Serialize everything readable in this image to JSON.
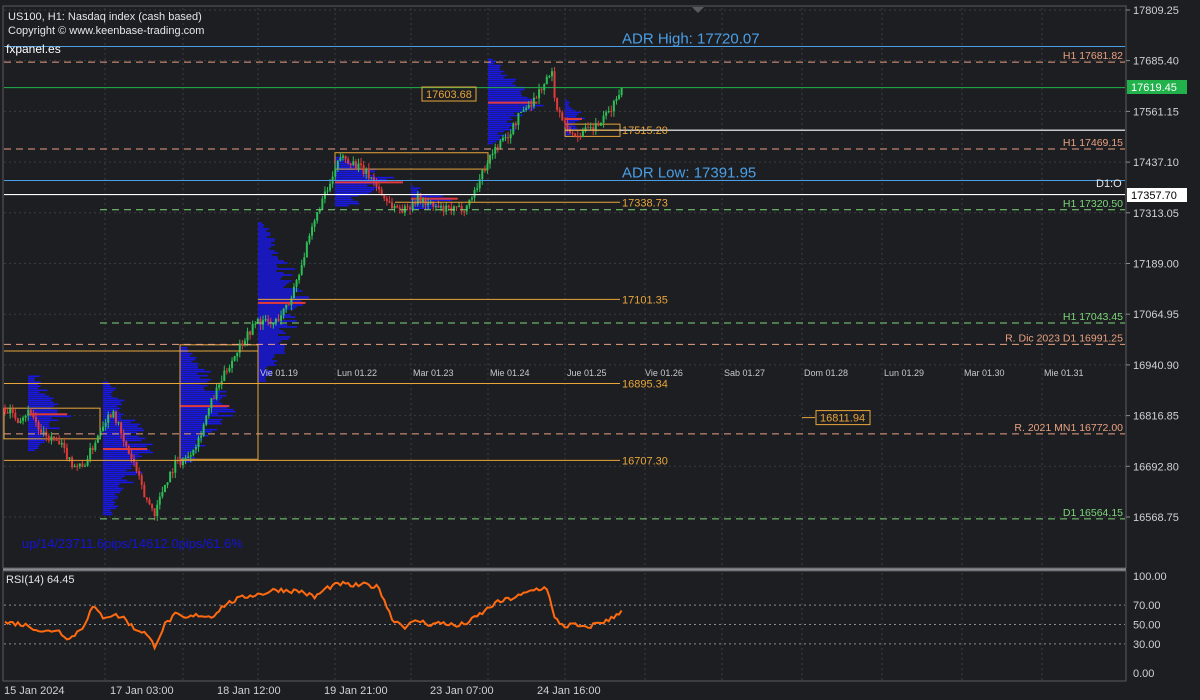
{
  "header": {
    "symbol_line": "US100, H1:  Nasdaq index (cash based)",
    "copyright": "Copyright © www.keenbase-trading.com",
    "brand": "fxpanel.es"
  },
  "colors": {
    "background": "#1d1e22",
    "grid": "#3a3b40",
    "bull_candle": "#2bbf55",
    "bear_candle": "#e03b3b",
    "volume_profile": "#1818e0",
    "poc": "#e03b3b",
    "adr": "#4a9fe6",
    "h1_resistance": "#e8a080",
    "support": "#7dd67a",
    "white_level": "#ffffff",
    "orange_level": "#e8a53a",
    "green_level": "#22b24c",
    "rsi": "#ff6a10",
    "stats_text": "#1414d8",
    "axis_text": "#d0d0d0"
  },
  "price_axis": {
    "ticks": [
      "17809.25",
      "17685.40",
      "17561.15",
      "17437.10",
      "17313.05",
      "17189.00",
      "17064.95",
      "16940.90",
      "16816.85",
      "16692.80",
      "16568.75"
    ],
    "current_price": "17619.45",
    "marker_price": "17357.70",
    "marker_label": "D1:O"
  },
  "chart_data": {
    "type": "candlestick",
    "title": "US100, H1:  Nasdaq index (cash based)",
    "ylim": [
      16540,
      17820
    ],
    "x_labels": [
      "15 Jan 2024",
      "17 Jan 03:00",
      "18 Jan 12:00",
      "19 Jan 21:00",
      "23 Jan 07:00",
      "24 Jan 16:00"
    ],
    "day_labels": [
      "Vie 01.19",
      "Lun 01.22",
      "Mar 01.23",
      "Mie 01.24",
      "Jue 01.25",
      "Vie 01.26",
      "Sab 01.27",
      "Dom 01.28",
      "Lun 01.29",
      "Mar 01.30",
      "Mie 01.31"
    ],
    "close_path": [
      [
        0,
        16835
      ],
      [
        5,
        16810
      ],
      [
        10,
        16830
      ],
      [
        14,
        16770
      ],
      [
        18,
        16760
      ],
      [
        22,
        16740
      ],
      [
        26,
        16700
      ],
      [
        30,
        16690
      ],
      [
        34,
        16740
      ],
      [
        38,
        16800
      ],
      [
        42,
        16830
      ],
      [
        46,
        16750
      ],
      [
        50,
        16700
      ],
      [
        54,
        16620
      ],
      [
        58,
        16580
      ],
      [
        62,
        16650
      ],
      [
        66,
        16700
      ],
      [
        70,
        16710
      ],
      [
        75,
        16760
      ],
      [
        80,
        16850
      ],
      [
        86,
        16930
      ],
      [
        92,
        17000
      ],
      [
        98,
        17050
      ],
      [
        104,
        17040
      ],
      [
        110,
        17090
      ],
      [
        116,
        17210
      ],
      [
        122,
        17330
      ],
      [
        126,
        17380
      ],
      [
        130,
        17450
      ],
      [
        134,
        17440
      ],
      [
        138,
        17420
      ],
      [
        142,
        17400
      ],
      [
        146,
        17360
      ],
      [
        150,
        17330
      ],
      [
        155,
        17320
      ],
      [
        160,
        17350
      ],
      [
        165,
        17330
      ],
      [
        170,
        17320
      ],
      [
        175,
        17320
      ],
      [
        179,
        17330
      ],
      [
        183,
        17380
      ],
      [
        187,
        17440
      ],
      [
        191,
        17480
      ],
      [
        195,
        17500
      ],
      [
        200,
        17560
      ],
      [
        205,
        17590
      ],
      [
        210,
        17640
      ],
      [
        212,
        17650
      ],
      [
        214,
        17560
      ],
      [
        217,
        17540
      ],
      [
        220,
        17500
      ],
      [
        224,
        17510
      ],
      [
        228,
        17520
      ],
      [
        232,
        17540
      ],
      [
        236,
        17580
      ],
      [
        239,
        17619.45
      ]
    ],
    "price_levels": [
      {
        "label": "ADR High: 17720.07",
        "value": 17720.07,
        "kind": "adr"
      },
      {
        "label": "ADR Low: 17391.95",
        "value": 17391.95,
        "kind": "adr"
      },
      {
        "label": "H1 17681.82",
        "value": 17681.82,
        "kind": "h1_resistance"
      },
      {
        "label": "H1 17469.15",
        "value": 17469.15,
        "kind": "h1_resistance"
      },
      {
        "label": "H1 17320.50",
        "value": 17320.5,
        "kind": "support"
      },
      {
        "label": "H1 17043.45",
        "value": 17043.45,
        "kind": "support"
      },
      {
        "label": "R. Dic 2023 D1 16991.25",
        "value": 16991.25,
        "kind": "h1_resistance"
      },
      {
        "label": "R. 2021  MN1 16772.00",
        "value": 16772.0,
        "kind": "h1_resistance"
      },
      {
        "label": "D1 16564.15",
        "value": 16564.15,
        "kind": "support"
      }
    ],
    "range_levels": [
      {
        "label": "17603.68",
        "value": 17603.68
      },
      {
        "label": "17515.20",
        "value": 17515.2
      },
      {
        "label": "17338.73",
        "value": 17338.73
      },
      {
        "label": "17101.35",
        "value": 17101.35
      },
      {
        "label": "16895.34",
        "value": 16895.34
      },
      {
        "label": "16811.94",
        "value": 16811.94
      },
      {
        "label": "16707.30",
        "value": 16707.3
      }
    ],
    "stats": "up/14/23711.6pips/14612.0pips/61.6%",
    "rsi": {
      "label": "RSI(14) 64.45",
      "value": 64.45,
      "ylim": [
        0,
        100
      ],
      "ticks": [
        "100.00",
        "70.00",
        "50.00",
        "30.00",
        "0.00"
      ],
      "path": [
        [
          0,
          52
        ],
        [
          5,
          51
        ],
        [
          10,
          48
        ],
        [
          15,
          42
        ],
        [
          20,
          45
        ],
        [
          25,
          35
        ],
        [
          30,
          47
        ],
        [
          34,
          68
        ],
        [
          38,
          58
        ],
        [
          42,
          60
        ],
        [
          46,
          57
        ],
        [
          50,
          46
        ],
        [
          54,
          42
        ],
        [
          58,
          28
        ],
        [
          62,
          50
        ],
        [
          66,
          60
        ],
        [
          70,
          56
        ],
        [
          75,
          60
        ],
        [
          80,
          58
        ],
        [
          85,
          70
        ],
        [
          90,
          76
        ],
        [
          95,
          80
        ],
        [
          100,
          82
        ],
        [
          105,
          86
        ],
        [
          110,
          85
        ],
        [
          115,
          84
        ],
        [
          120,
          78
        ],
        [
          125,
          88
        ],
        [
          130,
          92
        ],
        [
          135,
          90
        ],
        [
          140,
          91
        ],
        [
          145,
          88
        ],
        [
          150,
          56
        ],
        [
          155,
          48
        ],
        [
          160,
          54
        ],
        [
          165,
          50
        ],
        [
          170,
          52
        ],
        [
          175,
          48
        ],
        [
          180,
          53
        ],
        [
          185,
          62
        ],
        [
          190,
          72
        ],
        [
          195,
          76
        ],
        [
          200,
          80
        ],
        [
          205,
          86
        ],
        [
          210,
          88
        ],
        [
          213,
          56
        ],
        [
          217,
          48
        ],
        [
          220,
          50
        ],
        [
          225,
          46
        ],
        [
          230,
          52
        ],
        [
          234,
          54
        ],
        [
          239,
          64.45
        ]
      ]
    }
  }
}
